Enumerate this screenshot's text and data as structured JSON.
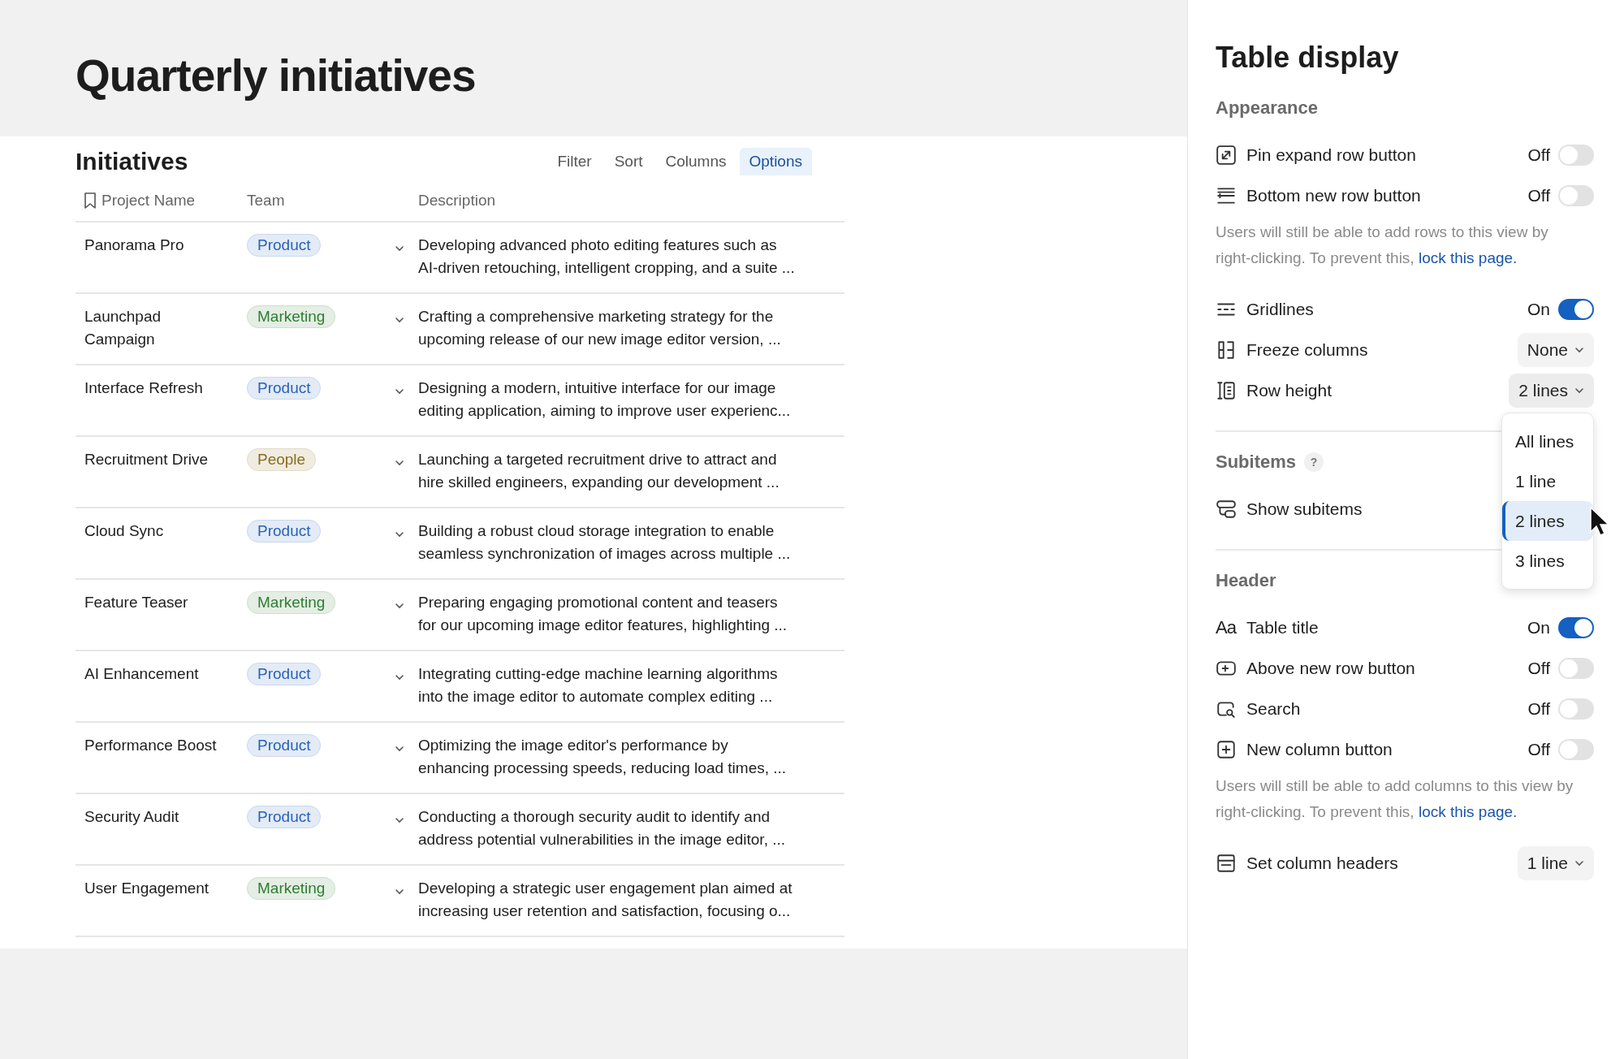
{
  "page": {
    "title": "Quarterly initiatives"
  },
  "table": {
    "title": "Initiatives",
    "toolbar": [
      {
        "label": "Filter",
        "selected": false
      },
      {
        "label": "Sort",
        "selected": false
      },
      {
        "label": "Columns",
        "selected": false
      },
      {
        "label": "Options",
        "selected": true
      }
    ],
    "columns": [
      "Project Name",
      "Team",
      "Description"
    ],
    "rows": [
      {
        "name": "Panorama Pro",
        "team": {
          "label": "Product",
          "color": "#2a62b8"
        },
        "description": "Developing advanced photo editing features such as\nAI-driven retouching, intelligent cropping, and a suite ..."
      },
      {
        "name": "Launchpad\nCampaign",
        "team": {
          "label": "Marketing",
          "color": "#2e7d32"
        },
        "description": "Crafting a comprehensive marketing strategy for the\nupcoming release of our new image editor version, ..."
      },
      {
        "name": "Interface Refresh",
        "team": {
          "label": "Product",
          "color": "#2a62b8"
        },
        "description": "Designing a modern, intuitive interface for our image\nediting application, aiming to improve user experienc..."
      },
      {
        "name": "Recruitment Drive",
        "team": {
          "label": "People",
          "color": "#8a6d1c"
        },
        "description": "Launching a targeted recruitment drive to attract and\nhire skilled engineers, expanding our development ..."
      },
      {
        "name": "Cloud Sync",
        "team": {
          "label": "Product",
          "color": "#2a62b8"
        },
        "description": "Building a robust cloud storage integration to enable\nseamless synchronization of images across multiple ..."
      },
      {
        "name": "Feature Teaser",
        "team": {
          "label": "Marketing",
          "color": "#2e7d32"
        },
        "description": "Preparing engaging promotional content and teasers\nfor our upcoming image editor features, highlighting ..."
      },
      {
        "name": "AI Enhancement",
        "team": {
          "label": "Product",
          "color": "#2a62b8"
        },
        "description": "Integrating cutting-edge machine learning algorithms\ninto the image editor to automate complex editing ..."
      },
      {
        "name": "Performance Boost",
        "team": {
          "label": "Product",
          "color": "#2a62b8"
        },
        "description": "Optimizing the image editor's performance by\nenhancing processing speeds, reducing load times, ..."
      },
      {
        "name": "Security Audit",
        "team": {
          "label": "Product",
          "color": "#2a62b8"
        },
        "description": "Conducting a thorough security audit to identify and\naddress potential vulnerabilities in the image editor, ..."
      },
      {
        "name": "User Engagement",
        "team": {
          "label": "Marketing",
          "color": "#2e7d32"
        },
        "description": "Developing a strategic user engagement plan aimed at\nincreasing user retention and satisfaction, focusing o..."
      }
    ]
  },
  "panel": {
    "title": "Table display",
    "sections": [
      {
        "title": "Appearance",
        "items": [
          {
            "kind": "toggle",
            "label": "Pin expand row button",
            "on": false,
            "state": "Off"
          },
          {
            "kind": "toggle",
            "label": "Bottom new row button",
            "on": false,
            "state": "Off"
          },
          {
            "kind": "note",
            "text": "Users will still be able to add rows to this view by right-clicking. To prevent this,",
            "link": "lock this page."
          },
          {
            "kind": "toggle",
            "label": "Gridlines",
            "on": true,
            "state": "On"
          },
          {
            "kind": "select",
            "label": "Freeze columns",
            "value": "None"
          },
          {
            "kind": "select",
            "label": "Row height",
            "value": "2 lines",
            "expanded": true,
            "options": [
              {
                "label": "All lines",
                "selected": false
              },
              {
                "label": "1 line",
                "selected": false
              },
              {
                "label": "2 lines",
                "selected": true
              },
              {
                "label": "3 lines",
                "selected": false
              }
            ]
          }
        ]
      },
      {
        "title": "Subitems",
        "help": "?",
        "items": [
          {
            "kind": "plain",
            "label": "Show subitems"
          }
        ]
      },
      {
        "title": "Header",
        "items": [
          {
            "kind": "toggle",
            "glyph": "Aa",
            "label": "Table title",
            "on": true,
            "state": "On"
          },
          {
            "kind": "toggle",
            "label": "Above new row button",
            "on": false,
            "state": "Off"
          },
          {
            "kind": "toggle",
            "label": "Search",
            "on": false,
            "state": "Off"
          },
          {
            "kind": "toggle",
            "label": "New column button",
            "on": false,
            "state": "Off"
          },
          {
            "kind": "note",
            "text": "Users will still be able to add columns to this view by right-clicking. To prevent this,",
            "link": "lock this page."
          },
          {
            "kind": "select",
            "label": "Set column headers",
            "value": "1 line"
          }
        ]
      }
    ]
  }
}
